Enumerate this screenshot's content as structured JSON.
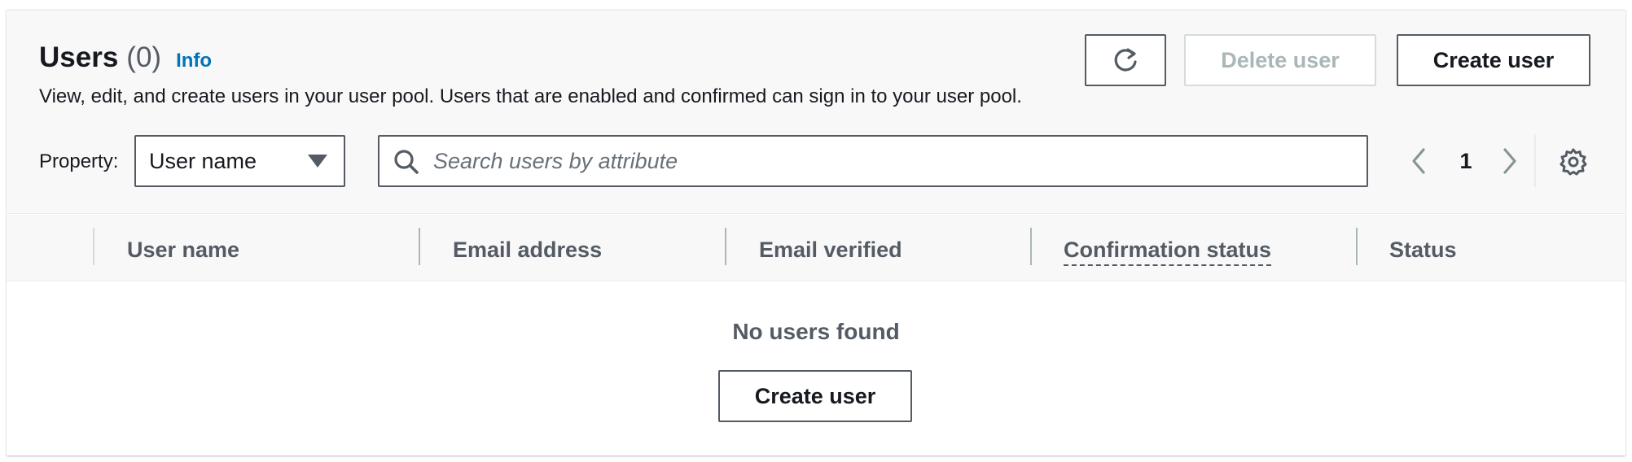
{
  "header": {
    "title": "Users",
    "count": "(0)",
    "info_label": "Info",
    "description": "View, edit, and create users in your user pool. Users that are enabled and confirmed can sign in to your user pool."
  },
  "actions": {
    "refresh_icon": "refresh-icon",
    "delete_label": "Delete user",
    "create_label": "Create user"
  },
  "filter": {
    "property_label": "Property:",
    "property_value": "User name",
    "search_placeholder": "Search users by attribute"
  },
  "pagination": {
    "current_page": "1"
  },
  "table": {
    "columns": [
      "User name",
      "Email address",
      "Email verified",
      "Confirmation status",
      "Status"
    ],
    "empty_message": "No users found",
    "empty_action_label": "Create user"
  },
  "colors": {
    "link": "#0073bb",
    "header_bg": "#f8f8f8",
    "text_primary": "#16191f",
    "text_secondary": "#545b64",
    "disabled": "#aab7b8"
  }
}
